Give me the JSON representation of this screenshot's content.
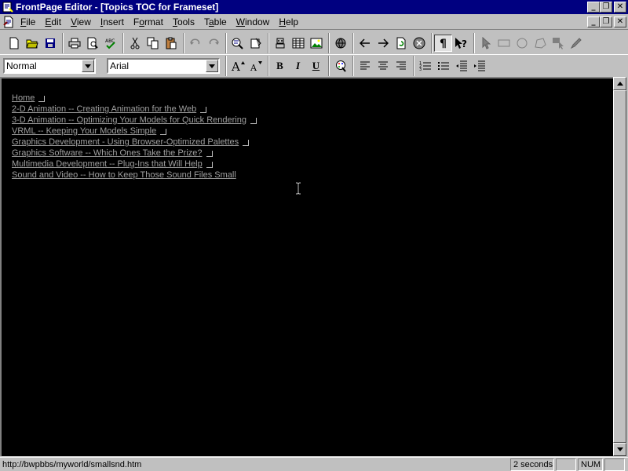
{
  "window": {
    "title": "FrontPage Editor - [Topics TOC for Frameset]",
    "minimize": "_",
    "restore": "❐",
    "close": "✕"
  },
  "menu": [
    {
      "label": "File",
      "key": "F",
      "rest": "ile"
    },
    {
      "label": "Edit",
      "key": "E",
      "rest": "dit"
    },
    {
      "label": "View",
      "key": "V",
      "rest": "iew"
    },
    {
      "label": "Insert",
      "key": "I",
      "rest": "nsert"
    },
    {
      "label": "Format",
      "key": "o",
      "pre": "F",
      "rest": "rmat"
    },
    {
      "label": "Tools",
      "key": "T",
      "rest": "ools"
    },
    {
      "label": "Table",
      "key": "a",
      "pre": "T",
      "rest": "ble"
    },
    {
      "label": "Window",
      "key": "W",
      "rest": "indow"
    },
    {
      "label": "Help",
      "key": "H",
      "rest": "elp"
    }
  ],
  "format_toolbar": {
    "style_value": "Normal",
    "font_value": "Arial",
    "bold": "B",
    "italic": "I",
    "underline": "U"
  },
  "document": {
    "links": [
      "Home",
      "2-D Animation -- Creating Animation for the Web",
      "3-D Animation -- Optimizing Your Models for Quick Rendering",
      "VRML -- Keeping Your Models Simple",
      "Graphics Development - Using Browser-Optimized Palettes",
      "Graphics Software -- Which Ones Take the Prize?",
      "Multimedia Development -- Plug-Ins that Will Help",
      "Sound and Video -- How to Keep Those Sound Files Small"
    ]
  },
  "status": {
    "url": "http://bwpbbs/myworld/smallsnd.htm",
    "time": "2 seconds",
    "num": "NUM"
  },
  "colors": {
    "titlebar": "#000080",
    "editor_bg": "#000000",
    "link": "#a0a0a0"
  }
}
